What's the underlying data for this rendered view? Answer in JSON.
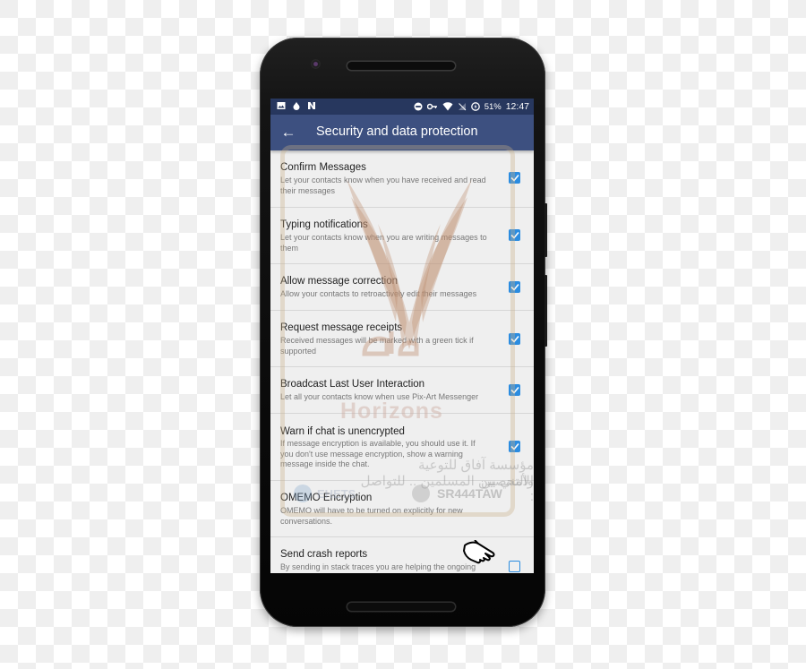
{
  "status_bar": {
    "left_icons": [
      "image-icon",
      "drop-icon",
      "n-icon"
    ],
    "right_icons": [
      "do-not-disturb-icon",
      "key-icon",
      "wifi-icon",
      "no-sim-icon",
      "battery-saver-icon"
    ],
    "battery": "51%",
    "time": "12:47"
  },
  "app_bar": {
    "back_icon": "arrow-left-icon",
    "back_glyph": "←",
    "title": "Security and data protection"
  },
  "settings": [
    {
      "title": "Confirm Messages",
      "summary": "Let your contacts know when you have received and read their messages",
      "checked": true
    },
    {
      "title": "Typing notifications",
      "summary": "Let your contacts know when you are writing messages to them",
      "checked": true
    },
    {
      "title": "Allow message correction",
      "summary": "Allow your contacts to retroactively edit their messages",
      "checked": true
    },
    {
      "title": "Request message receipts",
      "summary": "Received messages will be marked with a green tick if supported",
      "checked": true
    },
    {
      "title": "Broadcast Last User Interaction",
      "summary": "Let all your contacts know when use Pix-Art Messenger",
      "checked": true
    },
    {
      "title": "Warn if chat is unencrypted",
      "summary": "If message encryption is available, you should use it. If you don't use message encryption, show a warning message inside the chat.",
      "checked": true
    },
    {
      "title": "OMEMO Encryption",
      "summary": "OMEMO will have to be turned on explicitly for new conversations.",
      "checked": null
    },
    {
      "title": "Send crash reports",
      "summary": "By sending in stack traces you are helping the ongoing",
      "checked": false
    }
  ],
  "watermark": {
    "brand": "Horizons",
    "arabic_line1": "مؤسسة آفاق للتوعية والتحصين",
    "arabic_line2": "الأمني بين المسلمين .. للتواصل :",
    "handle_1": "SR444TAW",
    "handle_2": "EHETS"
  },
  "colors": {
    "status_bar": "#27375e",
    "app_bar": "#3d5080",
    "checkbox": "#2b8ce0",
    "background": "#efefef"
  }
}
